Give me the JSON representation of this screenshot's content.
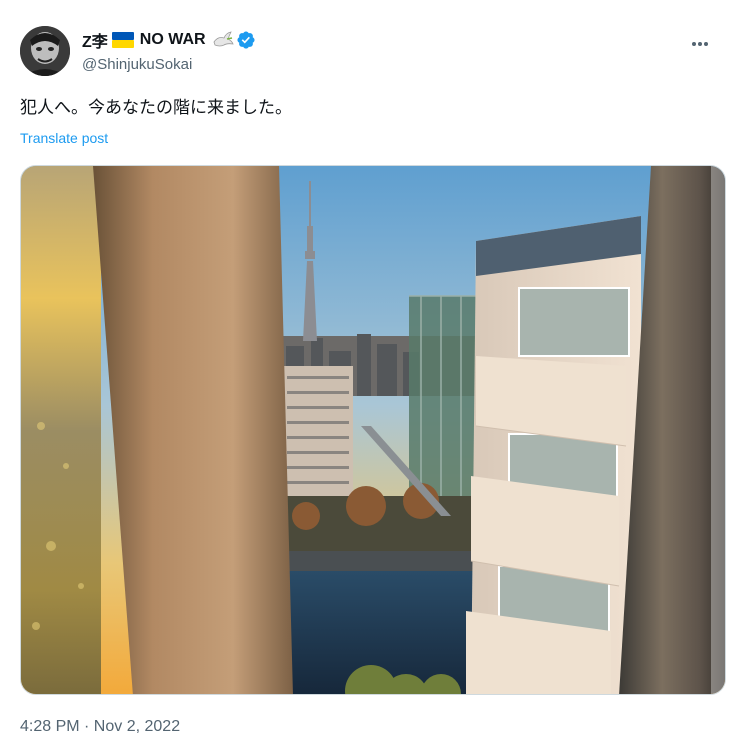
{
  "author": {
    "display_name": "Z李",
    "flag_emoji": "🇺🇦",
    "tagline": "NO WAR",
    "dove_emoji": "🕊️",
    "handle": "@ShinjukuSokai",
    "verified": true
  },
  "icons": {
    "more": "more-horizontal-icon",
    "verified": "verified-badge-icon",
    "flag": "ukraine-flag-icon",
    "dove": "dove-icon"
  },
  "colors": {
    "accent": "#1d9bf0",
    "text": "#0f1419",
    "secondary": "#536471",
    "flag_blue": "#0057b7",
    "flag_yellow": "#ffd700"
  },
  "post": {
    "text": "犯人へ。今あなたの階に来ました。",
    "translate_label": "Translate post",
    "timestamp": "4:28 PM · Nov 2, 2022"
  }
}
